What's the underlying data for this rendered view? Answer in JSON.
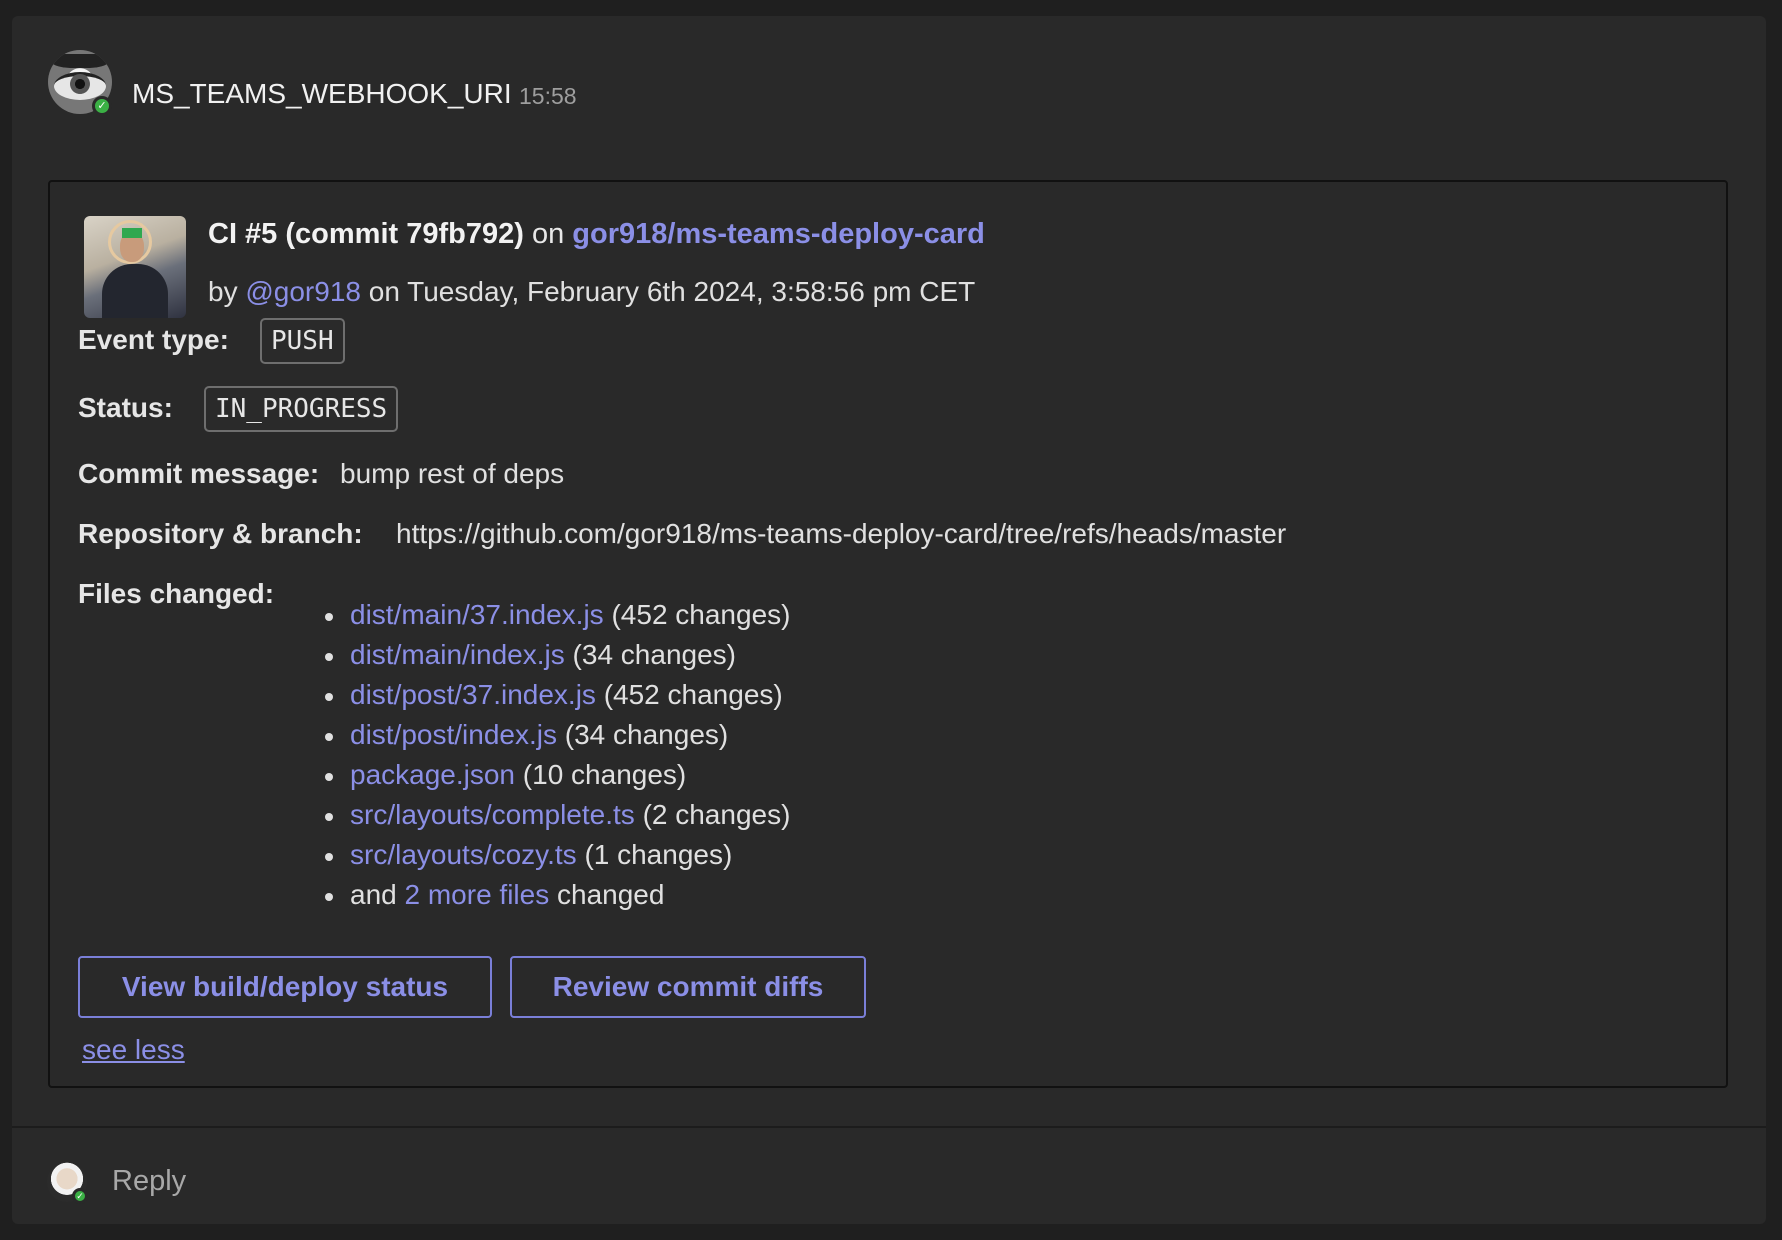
{
  "header": {
    "sender": "MS_TEAMS_WEBHOOK_URI",
    "time": "15:58",
    "presence": "available"
  },
  "card": {
    "title_bold": "CI #5 (commit 79fb792)",
    "title_on": "on",
    "repo_link": "gor918/ms-teams-deploy-card",
    "by_prefix": "by",
    "author": "@gor918",
    "date_text": "on Tuesday, February 6th 2024, 3:58:56 pm CET",
    "event_type_label": "Event type:",
    "event_type_value": "PUSH",
    "status_label": "Status:",
    "status_value": "IN_PROGRESS",
    "commit_message_label": "Commit message:",
    "commit_message_value": "bump rest of deps",
    "repo_branch_label": "Repository & branch:",
    "repo_branch_url": "https://github.com/gor918/ms-teams-deploy-card/tree/refs/heads/master",
    "files_changed_label": "Files changed:",
    "files": [
      {
        "path": "dist/main/37.index.js",
        "changes": "(452 changes)"
      },
      {
        "path": "dist/main/index.js",
        "changes": "(34 changes)"
      },
      {
        "path": "dist/post/37.index.js",
        "changes": "(452 changes)"
      },
      {
        "path": "dist/post/index.js",
        "changes": "(34 changes)"
      },
      {
        "path": "package.json",
        "changes": "(10 changes)"
      },
      {
        "path": "src/layouts/complete.ts",
        "changes": "(2 changes)"
      },
      {
        "path": "src/layouts/cozy.ts",
        "changes": "(1 changes)"
      }
    ],
    "more_prefix": "and",
    "more_link": "2 more files",
    "more_suffix": "changed",
    "buttons": {
      "view_status": "View build/deploy status",
      "review_diffs": "Review commit diffs"
    },
    "see_less": "see less"
  },
  "footer": {
    "reply": "Reply"
  },
  "colors": {
    "background": "#1f1f1f",
    "panel": "#292929",
    "link": "#8b8fe6",
    "presence": "#3bb045"
  }
}
